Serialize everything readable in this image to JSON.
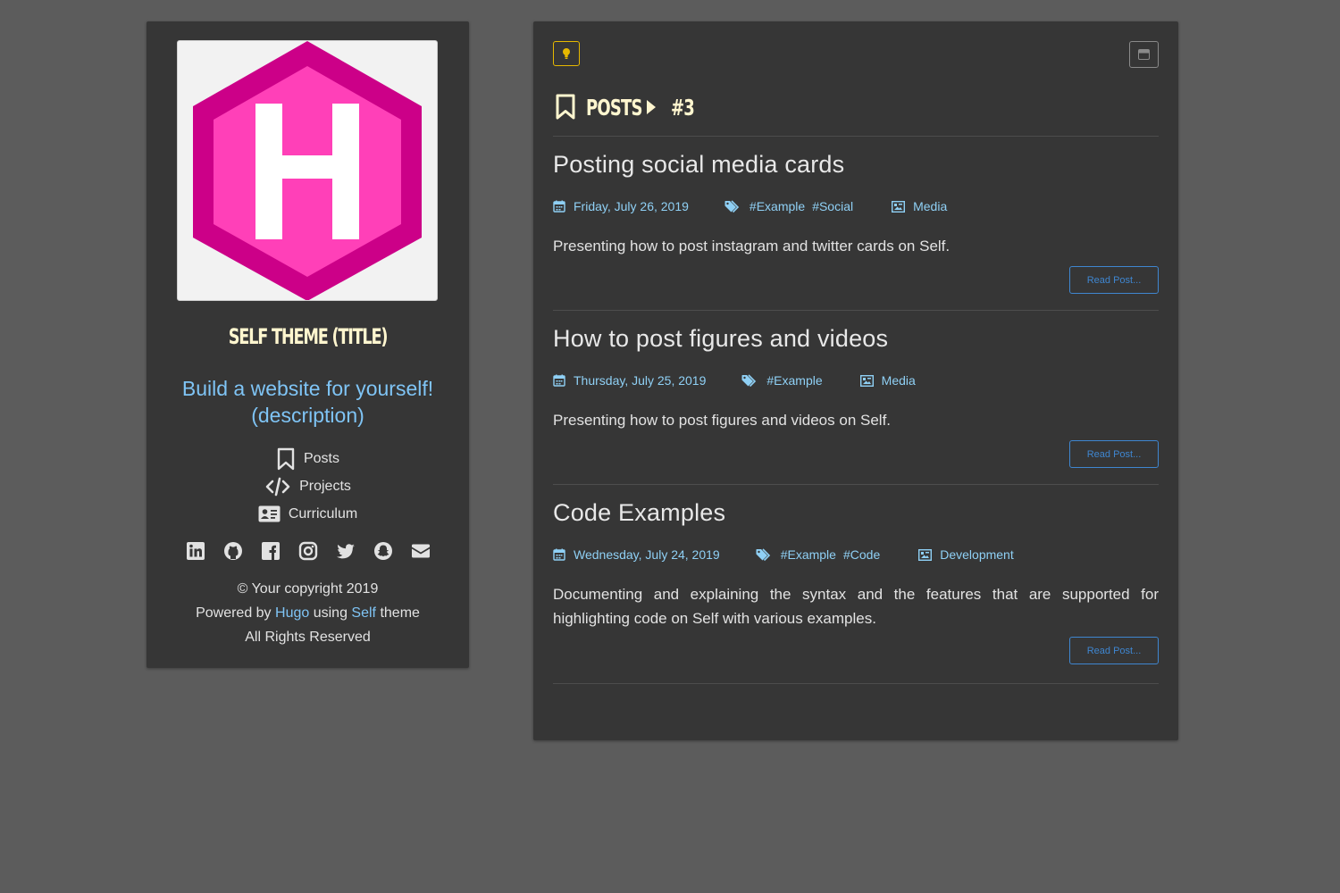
{
  "sidebar": {
    "title": "SELF THEME (TITLE)",
    "description": "Build a website for yourself! (description)",
    "nav": [
      {
        "label": "Posts",
        "icon": "bookmark-icon"
      },
      {
        "label": "Projects",
        "icon": "code-icon"
      },
      {
        "label": "Curriculum",
        "icon": "id-card-icon"
      }
    ],
    "socials": [
      "linkedin-icon",
      "github-icon",
      "facebook-icon",
      "instagram-icon",
      "twitter-icon",
      "snapchat-icon",
      "envelope-icon"
    ],
    "footer": {
      "copyright": "© Your copyright 2019",
      "powered_prefix": "Powered by",
      "hugo": "Hugo",
      "using": "using",
      "self": "Self",
      "theme": "theme",
      "rights": "All Rights Reserved"
    }
  },
  "breadcrumb": {
    "section": "POSTS",
    "page": "#3"
  },
  "posts": [
    {
      "title": "Posting social media cards",
      "date": "Friday, July 26, 2019",
      "tags": [
        "#Example",
        "#Social"
      ],
      "category": "Media",
      "summary": "Presenting how to post instagram and twitter cards on Self.",
      "button": "Read Post..."
    },
    {
      "title": "How to post figures and videos",
      "date": "Thursday, July 25, 2019",
      "tags": [
        "#Example"
      ],
      "category": "Media",
      "summary": "Presenting how to post figures and videos on Self.",
      "button": "Read Post..."
    },
    {
      "title": "Code Examples",
      "date": "Wednesday, July 24, 2019",
      "tags": [
        "#Example",
        "#Code"
      ],
      "category": "Development",
      "summary": "Documenting and explaining the syntax and the features that are supported for highlighting code on Self with various examples.",
      "button": "Read Post..."
    }
  ],
  "colors": {
    "background": "#5c5c5c",
    "panel": "#363636",
    "title": "#fff6cf",
    "link": "#7fc4f5",
    "button": "#3f86d0",
    "theme_toggle": "#e6b800",
    "logo_outer": "#cc0088",
    "logo_inner": "#ff40b8"
  }
}
